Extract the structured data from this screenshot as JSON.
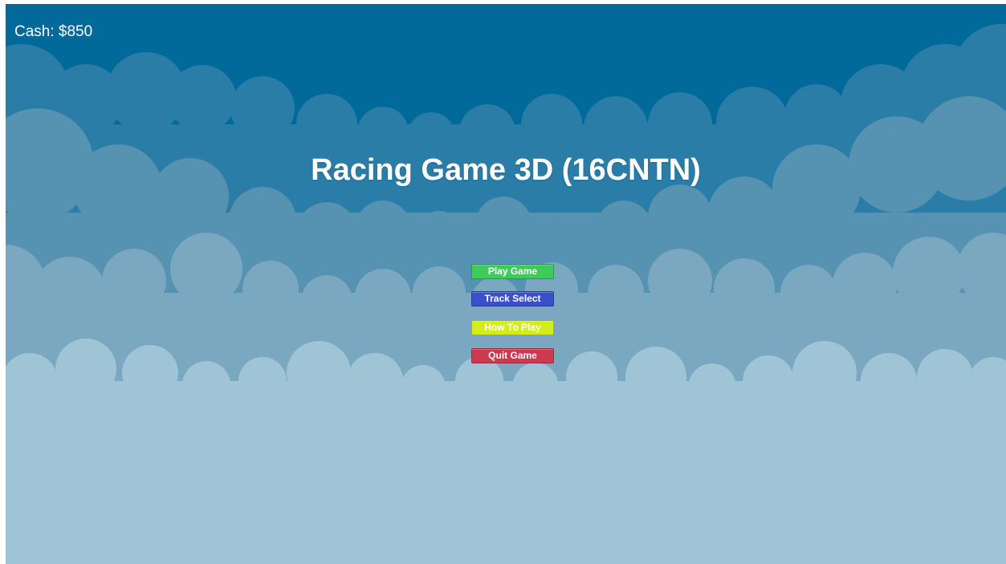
{
  "hud": {
    "cash_label": "Cash: $850"
  },
  "title": "Racing Game 3D (16CNTN)",
  "menu": {
    "buttons": [
      {
        "label": "Play Game",
        "color": "#3fca5c"
      },
      {
        "label": "Track Select",
        "color": "#3a4fcb"
      },
      {
        "label": "How To Play",
        "color": "#d4ec1c"
      },
      {
        "label": "Quit Game",
        "color": "#cc3a4e"
      }
    ]
  },
  "colors": {
    "sky_top": "#026a9a",
    "cloud_far": "#2a7da6",
    "cloud_mid": "#5692b1",
    "cloud_near": "#7ba8c1",
    "cloud_front": "#9fc4d6"
  }
}
